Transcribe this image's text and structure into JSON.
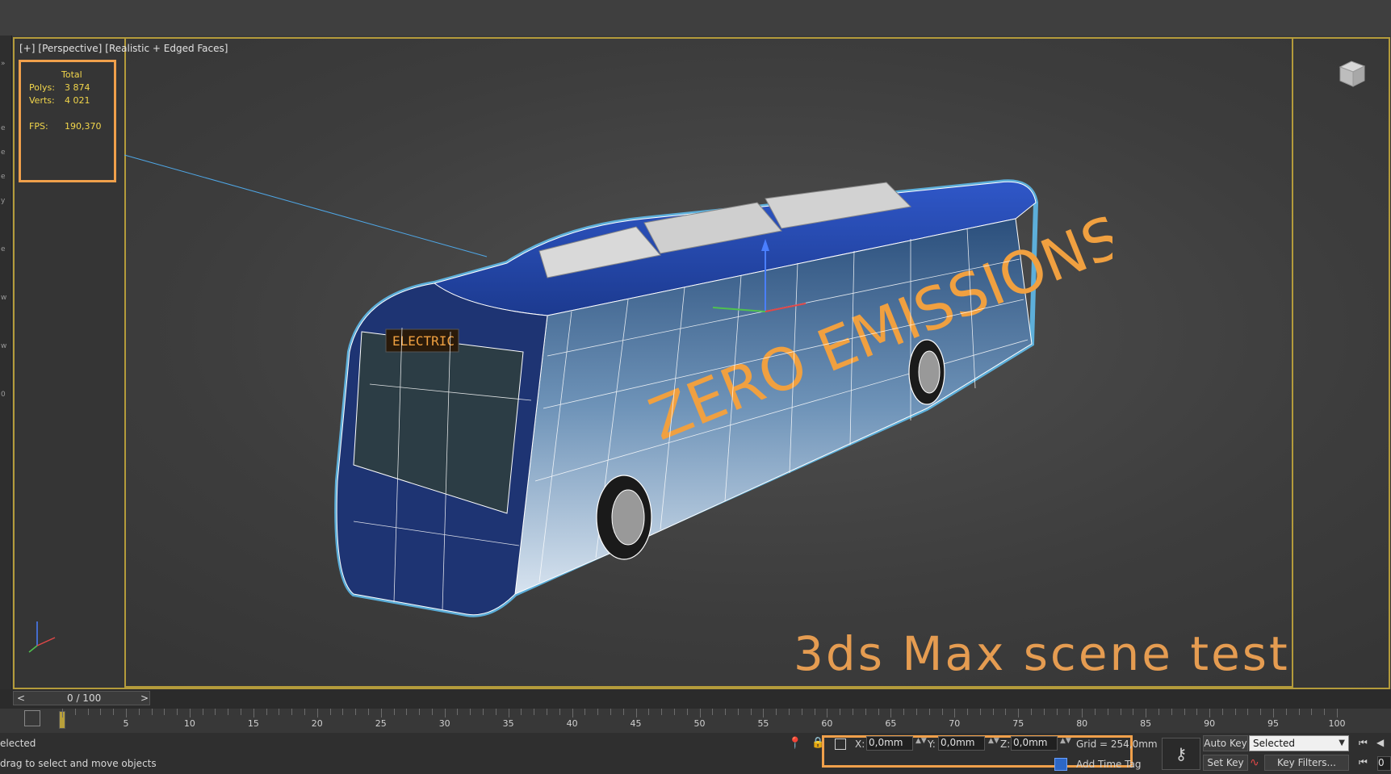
{
  "viewport": {
    "label_plus": "[+]",
    "label_view": "[Perspective]",
    "label_shading": "[Realistic + Edged Faces]",
    "stats": {
      "header": "Total",
      "polys_label": "Polys:",
      "polys_value": "3 874",
      "verts_label": "Verts:",
      "verts_value": "4 021",
      "fps_label": "FPS:",
      "fps_value": "190,370"
    },
    "caption": "3ds Max scene test",
    "bus_text_1": "ZERO EMISSIONS",
    "bus_text_2": "ELECTRIC BUS",
    "viewcube_icon": "viewcube-icon",
    "axis_icon": "axis-tripod-icon"
  },
  "timeline": {
    "prev": "<",
    "frame_display": "0 / 100",
    "next": ">",
    "ticks": [
      "5",
      "10",
      "15",
      "20",
      "25",
      "30",
      "35",
      "40",
      "45",
      "50",
      "55",
      "60",
      "65",
      "70",
      "75",
      "80",
      "85",
      "90",
      "95",
      "100"
    ]
  },
  "status": {
    "selected_text": "elected",
    "prompt_text": "drag to select and move objects",
    "x_label": "X:",
    "x_value": "0,0mm",
    "y_label": "Y:",
    "y_value": "0,0mm",
    "z_label": "Z:",
    "z_value": "0,0mm",
    "grid_text": "Grid = 254,0mm",
    "add_time_tag": "Add Time Tag",
    "auto_key": "Auto Key",
    "set_key": "Set Key",
    "selected_dropdown": "Selected",
    "key_filters": "Key Filters...",
    "frame_field": "0"
  },
  "colors": {
    "highlight_orange": "#f0a04b",
    "viewport_border": "#b49b3b",
    "stats_text": "#f2d64b"
  }
}
